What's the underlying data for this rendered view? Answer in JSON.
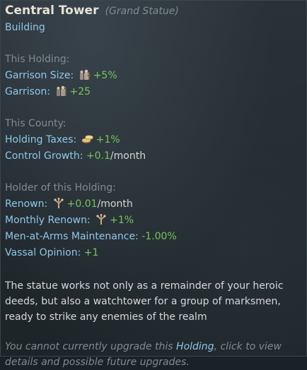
{
  "header": {
    "title": "Central Tower",
    "subtitle": "(Grand Statue)",
    "type": "Building"
  },
  "sections": {
    "holding": {
      "header": "This Holding:",
      "garrison_size": {
        "label": "Garrison Size:",
        "icon": "soldiers-icon",
        "value": "+5%"
      },
      "garrison": {
        "label": "Garrison:",
        "icon": "soldiers-icon",
        "value": "+25"
      }
    },
    "county": {
      "header": "This County:",
      "holding_taxes": {
        "label": "Holding Taxes:",
        "icon": "coins-icon",
        "value": "+1%"
      },
      "control_growth": {
        "label": "Control Growth:",
        "value": "+0.1",
        "unit": "/month"
      }
    },
    "holder": {
      "header": "Holder of this Holding:",
      "renown": {
        "label": "Renown:",
        "icon": "renown-tree-icon",
        "value": "+0.01",
        "unit": "/month"
      },
      "monthly_renown": {
        "label": "Monthly Renown:",
        "icon": "renown-tree-icon",
        "value": "+1%"
      },
      "maa_maintenance": {
        "label": "Men-at-Arms Maintenance:",
        "value": "-1.00%"
      },
      "vassal_opinion": {
        "label": "Vassal Opinion:",
        "value": "+1"
      }
    }
  },
  "description": "The statue works not only as a remainder of your heroic deeds, but also a watchtower for a group of marksmen, ready to strike any enemies of the realm",
  "footer": {
    "before": "You cannot currently upgrade this ",
    "link": "Holding",
    "after": ", click to view details and possible future upgrades."
  },
  "colors": {
    "accent_blue": "#8fc7e8",
    "positive_green": "#78c45a",
    "muted_gray": "#7f8a92"
  }
}
